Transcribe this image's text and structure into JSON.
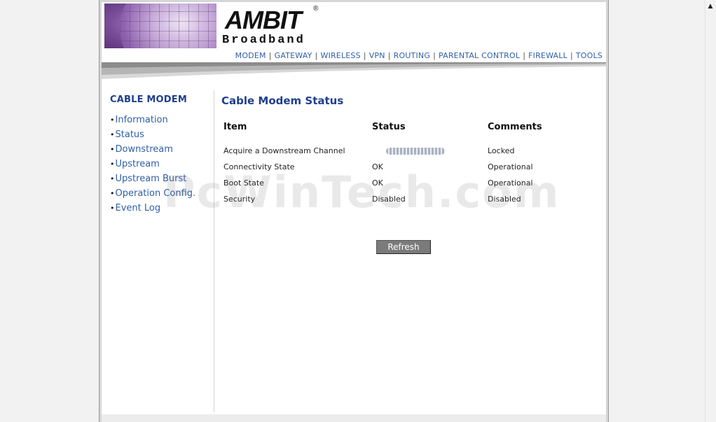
{
  "header": {
    "logo_main": "AMBIT",
    "logo_reg": "®",
    "logo_sub": "Broadband"
  },
  "nav": [
    {
      "label": "MODEM"
    },
    {
      "label": "GATEWAY"
    },
    {
      "label": "WIRELESS"
    },
    {
      "label": "VPN"
    },
    {
      "label": "ROUTING"
    },
    {
      "label": "PARENTAL CONTROL"
    },
    {
      "label": "FIREWALL"
    },
    {
      "label": "TOOLS"
    }
  ],
  "nav_separator": "|",
  "sidebar": {
    "title": "CABLE MODEM",
    "items": [
      {
        "label": "Information"
      },
      {
        "label": "Status"
      },
      {
        "label": "Downstream"
      },
      {
        "label": "Upstream"
      },
      {
        "label": "Upstream Burst"
      },
      {
        "label": "Operation Config."
      },
      {
        "label": "Event Log"
      }
    ]
  },
  "main": {
    "title": "Cable Modem Status",
    "columns": [
      "Item",
      "Status",
      "Comments"
    ],
    "rows": [
      {
        "item": "Acquire a Downstream Channel",
        "status": "",
        "comment": "Locked"
      },
      {
        "item": "Connectivity State",
        "status": "OK",
        "comment": "Operational"
      },
      {
        "item": "Boot State",
        "status": "OK",
        "comment": "Operational"
      },
      {
        "item": "Security",
        "status": "Disabled",
        "comment": "Disabled"
      }
    ],
    "refresh_label": "Refresh"
  },
  "watermark": "PcWinTech.com",
  "colors": {
    "accent": "#1f3f8f",
    "link": "#2f5fa8",
    "button": "#7b7b7b"
  }
}
